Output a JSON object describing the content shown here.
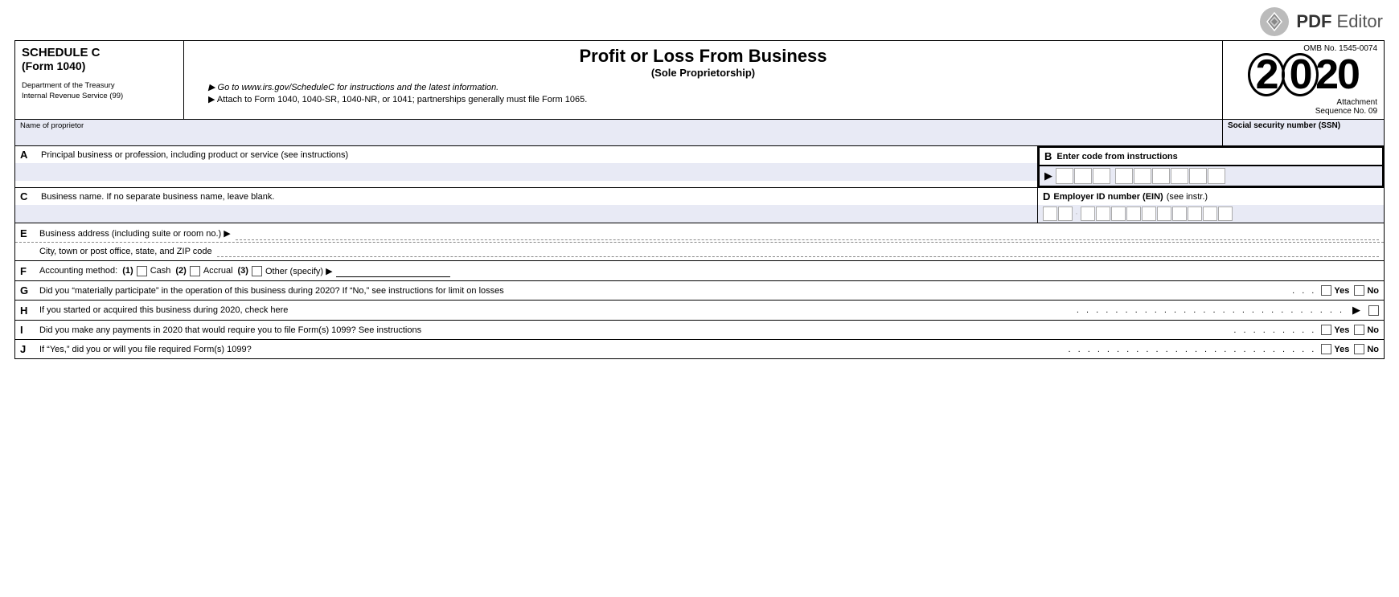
{
  "pdf_editor": {
    "label_pdf": "PDF",
    "label_editor": " Editor"
  },
  "form": {
    "schedule_title": "SCHEDULE C",
    "form_number": "(Form 1040)",
    "dept": "Department of the Treasury",
    "irs": "Internal Revenue Service (99)",
    "main_title": "Profit or Loss From Business",
    "subtitle": "(Sole Proprietorship)",
    "instruction1": "▶ Go to www.irs.gov/ScheduleC for instructions and the latest information.",
    "instruction2": "▶ Attach to Form 1040, 1040-SR, 1040-NR, or 1041; partnerships generally must file Form 1065.",
    "omb": "OMB No. 1545-0074",
    "year": "2020",
    "attachment": "Attachment",
    "sequence": "Sequence No. 09",
    "name_label": "Name of proprietor",
    "ssn_label": "Social security number (SSN)",
    "field_a_letter": "A",
    "field_a_label": "Principal business or profession, including product or service (see instructions)",
    "field_b_letter": "B",
    "field_b_label": "Enter code from instructions",
    "field_c_letter": "C",
    "field_c_label": "Business name. If no separate business name, leave blank.",
    "field_d_letter": "D",
    "field_d_label": "Employer ID number (EIN)",
    "field_d_instr": "(see instr.)",
    "field_e_letter": "E",
    "field_e_label": "Business address (including suite or room no.) ▶",
    "field_e_city": "City, town or post office, state, and ZIP code",
    "field_f_letter": "F",
    "field_f_label": "Accounting method:",
    "method1_num": "(1)",
    "method1_label": "Cash",
    "method2_num": "(2)",
    "method2_label": "Accrual",
    "method3_num": "(3)",
    "method3_label": "Other (specify) ▶",
    "field_g_letter": "G",
    "field_g_text": "Did you “materially participate” in the operation of this business during 2020? If “No,” see instructions for limit on losses",
    "field_h_letter": "H",
    "field_h_text": "If you started or acquired this business during 2020, check here",
    "field_i_letter": "I",
    "field_i_text": "Did you make any payments in 2020 that would require you to file Form(s) 1099? See instructions",
    "field_j_letter": "J",
    "field_j_text": "If “Yes,” did you or will you file required Form(s) 1099?",
    "yes_label": "Yes",
    "no_label": "No"
  },
  "colors": {
    "accent_blue": "#e8eaf5",
    "border": "#000000",
    "pdf_icon": "#888"
  }
}
